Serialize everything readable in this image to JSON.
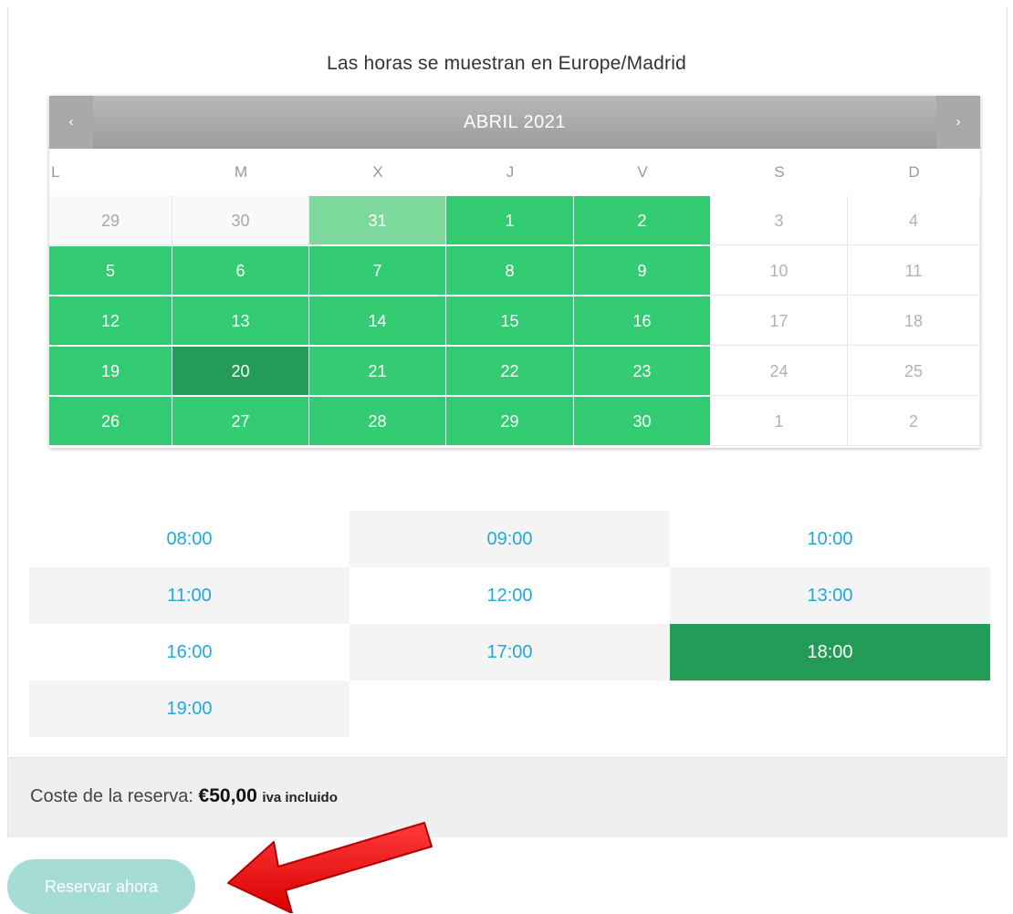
{
  "timezone_note": "Las horas se muestran en Europe/Madrid",
  "calendar": {
    "month_label": "ABRIL 2021",
    "prev_label": "‹",
    "next_label": "›",
    "weekdays": [
      "L",
      "M",
      "X",
      "J",
      "V",
      "S",
      "D"
    ],
    "weeks": [
      [
        {
          "d": "29",
          "s": "muted"
        },
        {
          "d": "30",
          "s": "muted"
        },
        {
          "d": "31",
          "s": "today"
        },
        {
          "d": "1",
          "s": "avail"
        },
        {
          "d": "2",
          "s": "avail"
        },
        {
          "d": "3",
          "s": "off"
        },
        {
          "d": "4",
          "s": "off"
        }
      ],
      [
        {
          "d": "5",
          "s": "avail"
        },
        {
          "d": "6",
          "s": "avail"
        },
        {
          "d": "7",
          "s": "avail"
        },
        {
          "d": "8",
          "s": "avail"
        },
        {
          "d": "9",
          "s": "avail"
        },
        {
          "d": "10",
          "s": "off"
        },
        {
          "d": "11",
          "s": "off"
        }
      ],
      [
        {
          "d": "12",
          "s": "avail"
        },
        {
          "d": "13",
          "s": "avail"
        },
        {
          "d": "14",
          "s": "avail"
        },
        {
          "d": "15",
          "s": "avail"
        },
        {
          "d": "16",
          "s": "avail"
        },
        {
          "d": "17",
          "s": "off"
        },
        {
          "d": "18",
          "s": "off"
        }
      ],
      [
        {
          "d": "19",
          "s": "avail"
        },
        {
          "d": "20",
          "s": "selected"
        },
        {
          "d": "21",
          "s": "avail"
        },
        {
          "d": "22",
          "s": "avail"
        },
        {
          "d": "23",
          "s": "avail"
        },
        {
          "d": "24",
          "s": "off"
        },
        {
          "d": "25",
          "s": "off"
        }
      ],
      [
        {
          "d": "26",
          "s": "avail"
        },
        {
          "d": "27",
          "s": "avail"
        },
        {
          "d": "28",
          "s": "avail"
        },
        {
          "d": "29",
          "s": "avail"
        },
        {
          "d": "30",
          "s": "avail"
        },
        {
          "d": "1",
          "s": "off"
        },
        {
          "d": "2",
          "s": "off"
        }
      ]
    ]
  },
  "time_slots": [
    {
      "label": "08:00",
      "shade": "plain"
    },
    {
      "label": "09:00",
      "shade": "shade"
    },
    {
      "label": "10:00",
      "shade": "plain"
    },
    {
      "label": "11:00",
      "shade": "shade"
    },
    {
      "label": "12:00",
      "shade": "plain"
    },
    {
      "label": "13:00",
      "shade": "shade"
    },
    {
      "label": "16:00",
      "shade": "plain"
    },
    {
      "label": "17:00",
      "shade": "shade"
    },
    {
      "label": "18:00",
      "shade": "selected"
    },
    {
      "label": "19:00",
      "shade": "shade"
    }
  ],
  "booking": {
    "cost_label": "Coste de la reserva:",
    "price": "€50,00",
    "vat_note": "iva incluido",
    "button_label": "Reservar ahora"
  },
  "colors": {
    "available": "#33cc72",
    "selected": "#229c57",
    "today": "#7dd99b",
    "time_text": "#1ea9de",
    "button": "#a6dcd6",
    "arrow": "#ee1111"
  },
  "icons": {
    "prev": "chevron-left-icon",
    "next": "chevron-right-icon",
    "annotation": "red-arrow-icon"
  }
}
